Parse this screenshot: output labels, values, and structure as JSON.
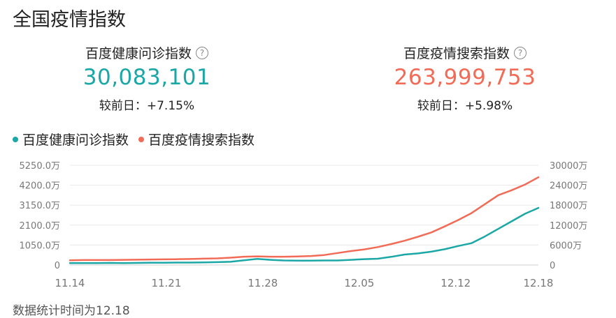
{
  "title": "全国疫情指数",
  "metrics": {
    "health": {
      "label": "百度健康问诊指数",
      "value": "30,083,101",
      "change_label": "较前日：",
      "change": "+7.15%"
    },
    "search": {
      "label": "百度疫情搜索指数",
      "value": "263,999,753",
      "change_label": "较前日：",
      "change": "+5.98%"
    }
  },
  "help_icon": "?",
  "colors": {
    "health": "#1aa7a5",
    "search": "#f26b57",
    "grid": "#e8e8e8",
    "axis_text": "#777777"
  },
  "footer": "数据统计时间为12.18",
  "chart_data": {
    "type": "line",
    "x": [
      "11.14",
      "11.15",
      "11.16",
      "11.17",
      "11.18",
      "11.19",
      "11.20",
      "11.21",
      "11.22",
      "11.23",
      "11.24",
      "11.25",
      "11.26",
      "11.27",
      "11.28",
      "11.29",
      "11.30",
      "12.01",
      "12.02",
      "12.03",
      "12.04",
      "12.05",
      "12.06",
      "12.07",
      "12.08",
      "12.09",
      "12.10",
      "12.11",
      "12.12",
      "12.13",
      "12.14",
      "12.15",
      "12.16",
      "12.17",
      "12.18"
    ],
    "x_ticks": [
      "11.14",
      "11.21",
      "11.28",
      "12.05",
      "12.12",
      "12.18"
    ],
    "y_left": {
      "ticks": [
        "0",
        "1050.0万",
        "2100.0万",
        "3150.0万",
        "4200.0万",
        "5250.0万"
      ],
      "lim": [
        0,
        5250
      ]
    },
    "y_right": {
      "ticks": [
        "0",
        "6000万",
        "12000万",
        "18000万",
        "24000万",
        "30000万"
      ],
      "lim": [
        0,
        30000
      ]
    },
    "grid": true,
    "legend_position": "top-left",
    "series": [
      {
        "name": "百度健康问诊指数",
        "axis": "left",
        "values": [
          100,
          100,
          100,
          110,
          100,
          110,
          120,
          120,
          130,
          130,
          140,
          150,
          170,
          250,
          320,
          270,
          240,
          230,
          230,
          240,
          240,
          270,
          310,
          330,
          430,
          550,
          610,
          700,
          830,
          1000,
          1150,
          1500,
          1900,
          2300,
          2700,
          3008
        ]
      },
      {
        "name": "百度疫情搜索指数",
        "axis": "right",
        "values": [
          1400,
          1500,
          1500,
          1500,
          1550,
          1600,
          1650,
          1700,
          1750,
          1800,
          1900,
          2000,
          2200,
          2500,
          2600,
          2500,
          2500,
          2550,
          2700,
          3000,
          3600,
          4200,
          4700,
          5400,
          6300,
          7300,
          8500,
          9800,
          11600,
          13500,
          15600,
          18300,
          21000,
          22500,
          24200,
          26400
        ]
      }
    ]
  }
}
